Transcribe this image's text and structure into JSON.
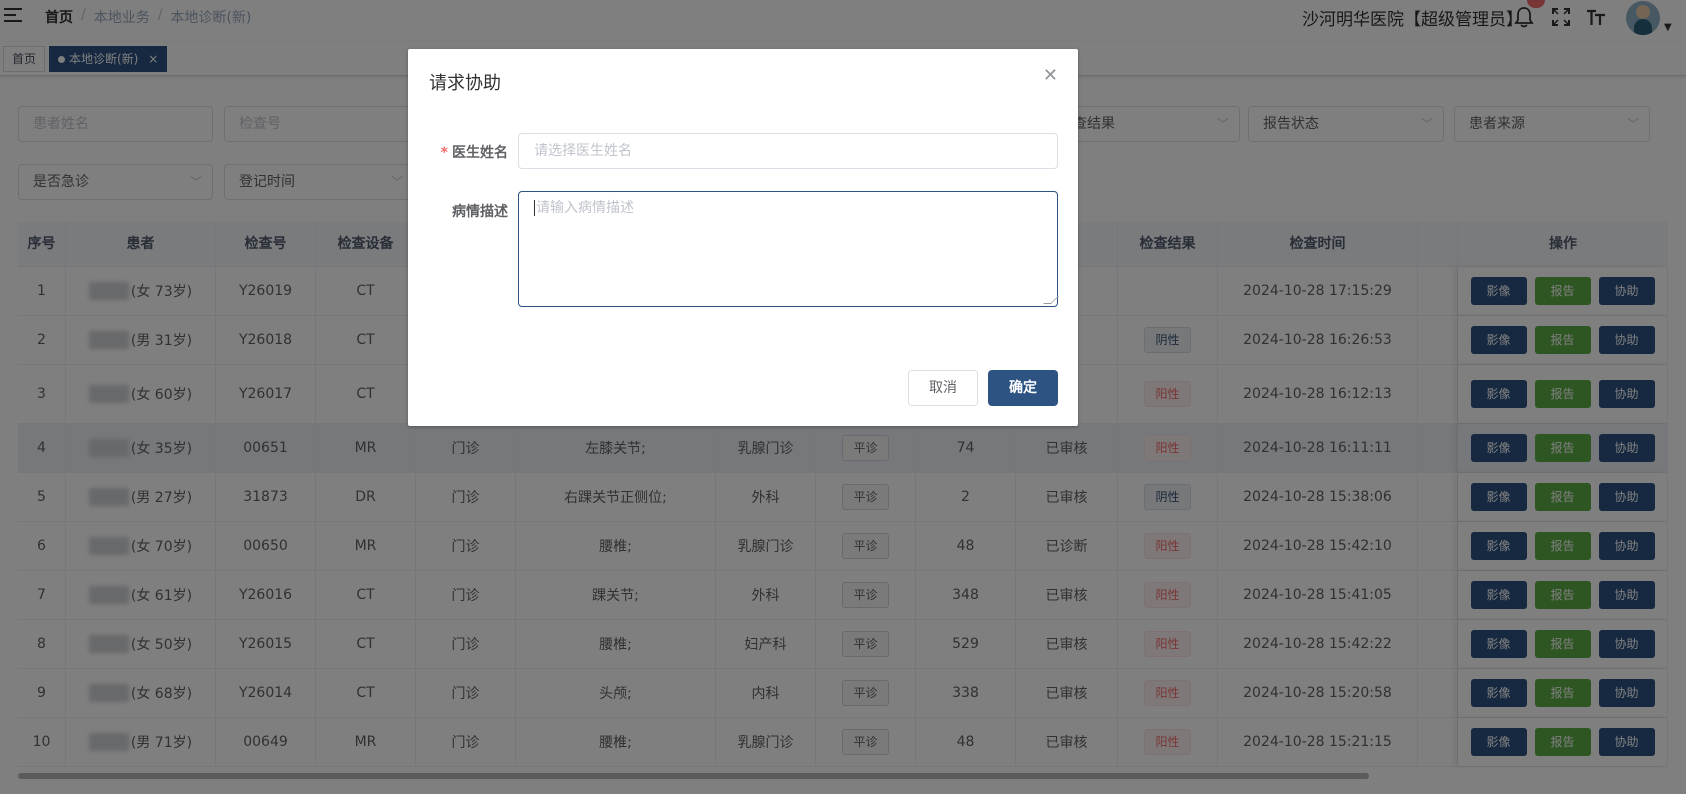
{
  "header": {
    "breadcrumb": [
      "首页",
      "本地业务",
      "本地诊断(新)"
    ],
    "hospital": "沙河明华医院【超级管理员】"
  },
  "tabs": [
    {
      "label": "首页"
    },
    {
      "label": "本地诊断(新)"
    }
  ],
  "filters": {
    "patient_name": "患者姓名",
    "exam_no": "检查号",
    "exam_result": "查结果",
    "report_status": "报告状态",
    "patient_source": "患者来源",
    "is_emergency": "是否急诊",
    "register_time": "登记时间"
  },
  "table": {
    "headers": {
      "seq": "序号",
      "patient": "患者",
      "exam_no": "检查号",
      "device": "检查设备",
      "status_partial": "态",
      "result": "检查结果",
      "time": "检查时间",
      "ops": "操作"
    },
    "ops": {
      "image": "影像",
      "report": "报告",
      "assist": "协助"
    },
    "rows": [
      {
        "seq": "1",
        "name_tail": "(女 73岁)",
        "exam_no": "Y26019",
        "device": "CT",
        "status": "查",
        "result": "",
        "time": "2024-10-28 17:15:29"
      },
      {
        "seq": "2",
        "name_tail": "(男 31岁)",
        "exam_no": "Y26018",
        "device": "CT",
        "status": "核",
        "result": "阴性",
        "time": "2024-10-28 16:26:53"
      },
      {
        "seq": "3",
        "name_tail": "(女 60岁)",
        "exam_no": "Y26017",
        "device": "CT",
        "status": "核",
        "result": "阳性",
        "time": "2024-10-28 16:12:13"
      },
      {
        "seq": "4",
        "name_tail": "(女 35岁)",
        "exam_no": "00651",
        "device": "MR",
        "source": "门诊",
        "part": "左膝关节;",
        "dept": "乳腺门诊",
        "level": "平诊",
        "count": "74",
        "status": "已审核",
        "result": "阳性",
        "time": "2024-10-28 16:11:11"
      },
      {
        "seq": "5",
        "name_tail": "(男 27岁)",
        "exam_no": "31873",
        "device": "DR",
        "source": "门诊",
        "part": "右踝关节正侧位;",
        "dept": "外科",
        "level": "平诊",
        "count": "2",
        "status": "已审核",
        "result": "阴性",
        "time": "2024-10-28 15:38:06"
      },
      {
        "seq": "6",
        "name_tail": "(女 70岁)",
        "exam_no": "00650",
        "device": "MR",
        "source": "门诊",
        "part": "腰椎;",
        "dept": "乳腺门诊",
        "level": "平诊",
        "count": "48",
        "status": "已诊断",
        "result": "阳性",
        "time": "2024-10-28 15:42:10"
      },
      {
        "seq": "7",
        "name_tail": "(女 61岁)",
        "exam_no": "Y26016",
        "device": "CT",
        "source": "门诊",
        "part": "踝关节;",
        "dept": "外科",
        "level": "平诊",
        "count": "348",
        "status": "已审核",
        "result": "阳性",
        "time": "2024-10-28 15:41:05"
      },
      {
        "seq": "8",
        "name_tail": "(女 50岁)",
        "exam_no": "Y26015",
        "device": "CT",
        "source": "门诊",
        "part": "腰椎;",
        "dept": "妇产科",
        "level": "平诊",
        "count": "529",
        "status": "已审核",
        "result": "阳性",
        "time": "2024-10-28 15:42:22"
      },
      {
        "seq": "9",
        "name_tail": "(女 68岁)",
        "exam_no": "Y26014",
        "device": "CT",
        "source": "门诊",
        "part": "头颅;",
        "dept": "内科",
        "level": "平诊",
        "count": "338",
        "status": "已审核",
        "result": "阳性",
        "time": "2024-10-28 15:20:58"
      },
      {
        "seq": "10",
        "name_tail": "(男 71岁)",
        "exam_no": "00649",
        "device": "MR",
        "source": "门诊",
        "part": "腰椎;",
        "dept": "乳腺门诊",
        "level": "平诊",
        "count": "48",
        "status": "已审核",
        "result": "阳性",
        "time": "2024-10-28 15:21:15"
      }
    ]
  },
  "dialog": {
    "title": "请求协助",
    "doctor_label": "医生姓名",
    "doctor_placeholder": "请选择医生姓名",
    "desc_label": "病情描述",
    "desc_placeholder": "请输入病情描述",
    "cancel": "取消",
    "confirm": "确定"
  },
  "colors": {
    "primary": "#2c5382",
    "success": "#5aad45",
    "danger": "#f56c6c"
  }
}
